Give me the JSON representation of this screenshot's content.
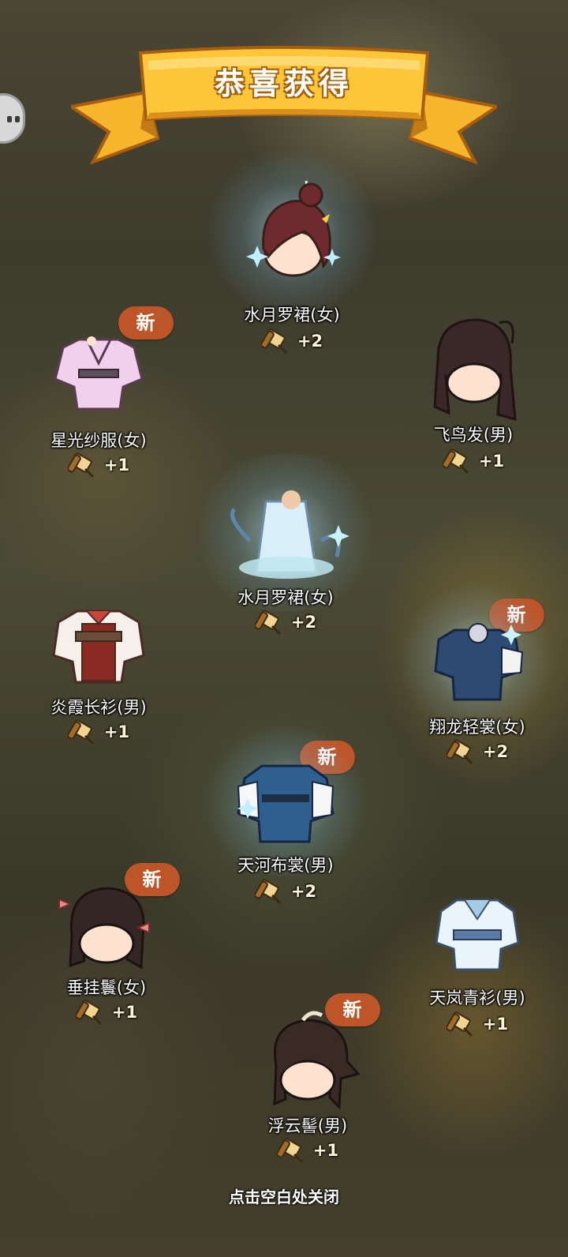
{
  "banner": {
    "title": "恭喜获得"
  },
  "colors": {
    "banner": "#f6b82a",
    "badge": "#bd5528",
    "text": "#ffffff",
    "count": "#fff6d6"
  },
  "items": [
    {
      "name": "水月罗裙(女)",
      "count": "+2",
      "badge": "",
      "icon": "hair-maroon-bun"
    },
    {
      "name": "星光纱服(女)",
      "count": "+1",
      "badge": "新",
      "icon": "robe-pink"
    },
    {
      "name": "飞鸟发(男)",
      "count": "+1",
      "badge": "",
      "icon": "hair-long-dark"
    },
    {
      "name": "水月罗裙(女)",
      "count": "+2",
      "badge": "",
      "icon": "dress-water-moon"
    },
    {
      "name": "炎霞长衫(男)",
      "count": "+1",
      "badge": "",
      "icon": "robe-red"
    },
    {
      "name": "翔龙轻裳(女)",
      "count": "+2",
      "badge": "新",
      "icon": "robe-dragon-blue"
    },
    {
      "name": "天河布裳(男)",
      "count": "+2",
      "badge": "新",
      "icon": "robe-sky-river"
    },
    {
      "name": "垂挂鬟(女)",
      "count": "+1",
      "badge": "新",
      "icon": "hair-bows"
    },
    {
      "name": "天岚青衫(男)",
      "count": "+1",
      "badge": "",
      "icon": "robe-light-blue"
    },
    {
      "name": "浮云髻(男)",
      "count": "+1",
      "badge": "新",
      "icon": "hair-topknot"
    }
  ],
  "footer": {
    "hint": "点击空白处关闭"
  }
}
